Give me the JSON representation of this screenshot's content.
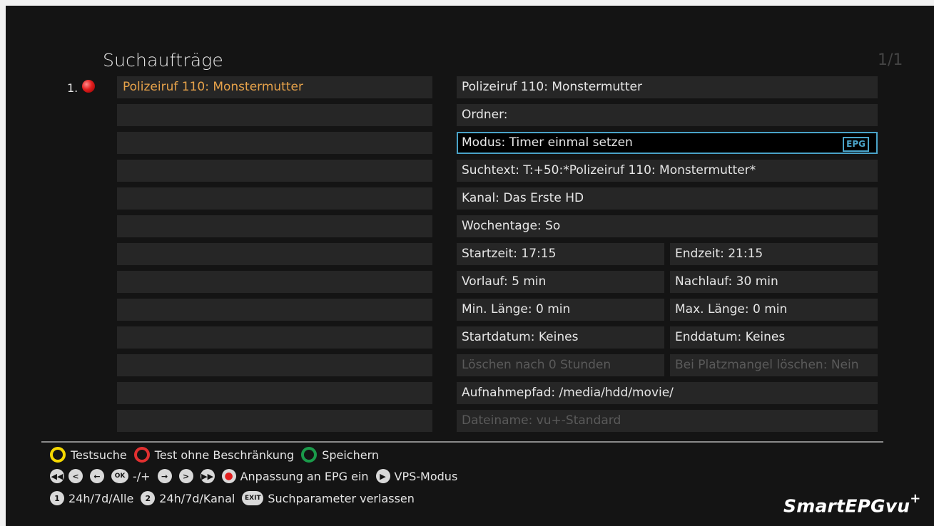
{
  "header": {
    "title": "Suchaufträge",
    "page_indicator": "1/1"
  },
  "list": {
    "items": [
      {
        "index": "1.",
        "label": "Polizeiruf 110: Monstermutter",
        "icon": "record-dot-icon",
        "color": "#e6a24a"
      }
    ]
  },
  "details": {
    "name": "Polizeiruf 110: Monstermutter",
    "ordner": "Ordner:",
    "modus": "Modus: Timer einmal setzen",
    "epg_badge": "EPG",
    "suchtext": "Suchtext: T:+50:*Polizeiruf 110: Monstermutter*",
    "kanal": "Kanal: Das Erste HD",
    "wochentage": "Wochentage:  So",
    "startzeit": "Startzeit: 17:15",
    "endzeit": "Endzeit: 21:15",
    "vorlauf": "Vorlauf: 5 min",
    "nachlauf": "Nachlauf: 30 min",
    "min_laenge": "Min. Länge: 0 min",
    "max_laenge": "Max. Länge: 0 min",
    "startdatum": "Startdatum: Keines",
    "enddatum": "Enddatum: Keines",
    "loeschen": "Löschen nach 0 Stunden",
    "platzmangel": "Bei Platzmangel löschen: Nein",
    "aufnahmepfad": "Aufnahmepfad: /media/hdd/movie/",
    "dateiname": "Dateiname: vu+-Standard",
    "selection_color": "#4aa3c8"
  },
  "help": {
    "row1": {
      "yellow_label": "Testsuche",
      "red_label": "Test ohne Beschränkung",
      "green_label": "Speichern"
    },
    "row2": {
      "ok_key": "OK",
      "ok_label": "-/+",
      "record_label": "Anpassung an EPG ein",
      "play_label": "VPS-Modus"
    },
    "row3": {
      "key1": "1",
      "key1_label": "24h/7d/Alle",
      "key2": "2",
      "key2_label": "24h/7d/Kanal",
      "exit_key": "EXIT",
      "exit_label": "Suchparameter verlassen"
    }
  },
  "brand": {
    "name": "SmartEPGvu",
    "suffix": "+"
  }
}
